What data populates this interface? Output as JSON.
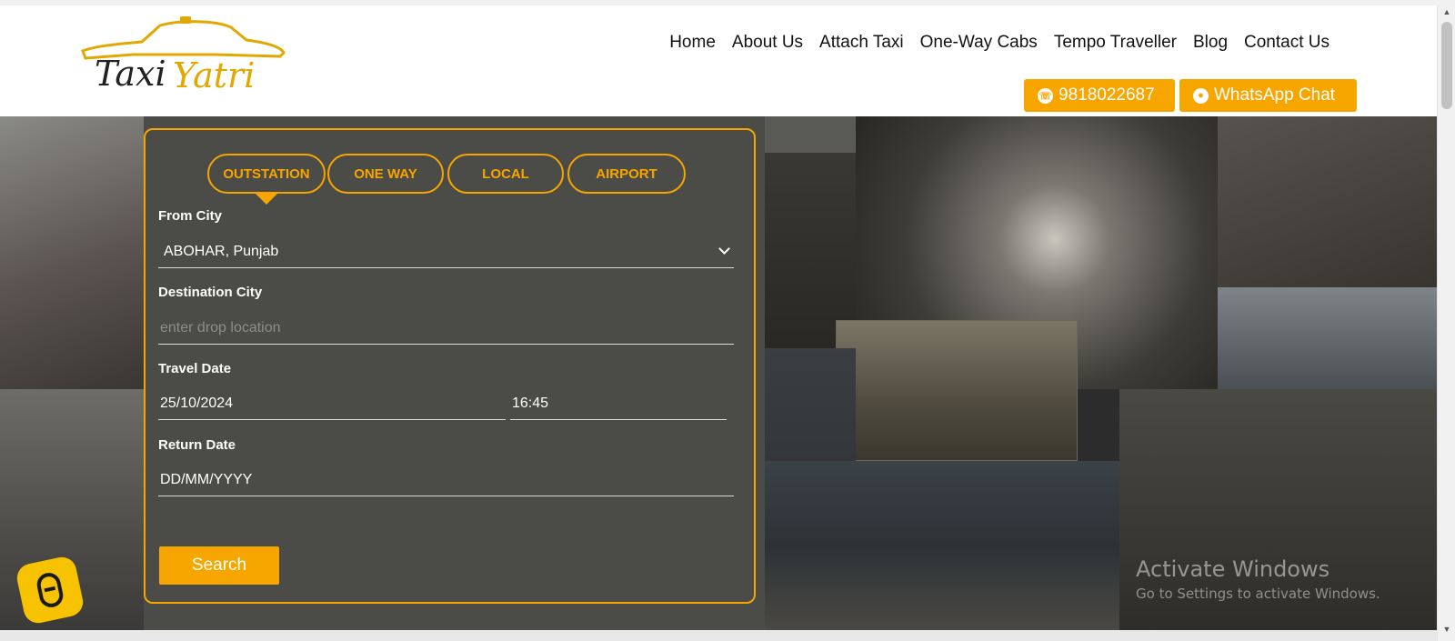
{
  "logo": {
    "text_part1": "Taxi",
    "text_part2": "Yatri"
  },
  "nav": {
    "items": [
      {
        "label": "Home"
      },
      {
        "label": "About Us"
      },
      {
        "label": "Attach Taxi"
      },
      {
        "label": "One-Way Cabs"
      },
      {
        "label": "Tempo Traveller"
      },
      {
        "label": "Blog"
      },
      {
        "label": "Contact Us"
      }
    ]
  },
  "cta": {
    "phone_label": "9818022687",
    "phone_icon": "phone-icon",
    "whatsapp_label": "WhatsApp Chat",
    "whatsapp_icon": "whatsapp-icon"
  },
  "booking": {
    "tabs": [
      {
        "label": "OUTSTATION",
        "active": true
      },
      {
        "label": "ONE WAY",
        "active": false
      },
      {
        "label": "LOCAL",
        "active": false
      },
      {
        "label": "AIRPORT",
        "active": false
      }
    ],
    "from_city": {
      "label": "From City",
      "value": "ABOHAR, Punjab"
    },
    "destination_city": {
      "label": "Destination City",
      "placeholder": "enter drop location"
    },
    "travel_date": {
      "label": "Travel Date",
      "date_value": "25/10/2024",
      "time_value": "16:45"
    },
    "return_date": {
      "label": "Return Date",
      "value": "DD/MM/YYYY"
    },
    "search_label": "Search"
  },
  "chatbot": {
    "icon": "chat-widget-icon"
  },
  "watermark": {
    "line1": "Activate Windows",
    "line2": "Go to Settings to activate Windows."
  },
  "colors": {
    "accent": "#f7a600",
    "panel": "#4b4b47",
    "chatbot": "#f7c300"
  }
}
